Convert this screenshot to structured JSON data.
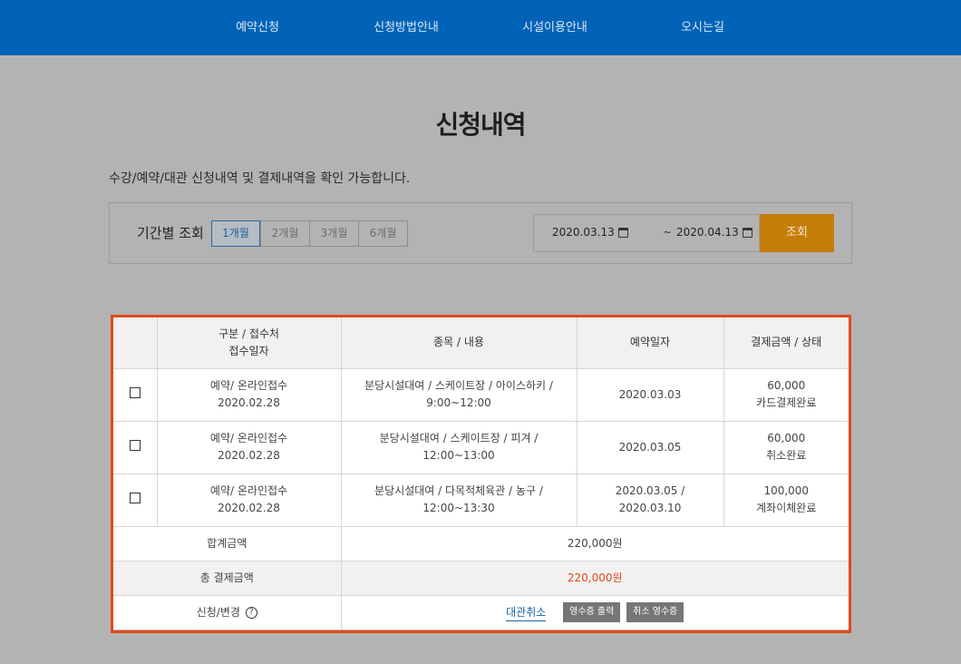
{
  "nav": {
    "items": [
      {
        "label": "예약신청"
      },
      {
        "label": "신청방법안내"
      },
      {
        "label": "시설이용안내"
      },
      {
        "label": "오시는길"
      }
    ]
  },
  "page": {
    "title": "신청내역",
    "description": "수강/예약/대관 신청내역 및 결제내역을 확인 가능합니다."
  },
  "filter": {
    "label": "기간별 조회",
    "periods": [
      {
        "label": "1개월",
        "active": true
      },
      {
        "label": "2개월",
        "active": false
      },
      {
        "label": "3개월",
        "active": false
      },
      {
        "label": "6개월",
        "active": false
      }
    ],
    "start_date": "2020.03.13",
    "separator": "~",
    "end_date": "2020.04.13",
    "search_label": "조회"
  },
  "table": {
    "headers": {
      "col1_line1": "구분 / 접수처",
      "col1_line2": "접수일자",
      "col2": "종목 / 내용",
      "col3": "예약일자",
      "col4": "결제금액 / 상태"
    },
    "rows": [
      {
        "type": "예약/ 온라인접수",
        "received": "2020.02.28",
        "content_line1": "분당시설대여 / 스케이트장 / 아이스하키 /",
        "content_line2": "9:00~12:00",
        "date_line1": "2020.03.03",
        "date_line2": "",
        "amount": "60,000",
        "status": "카드결제완료"
      },
      {
        "type": "예약/ 온라인접수",
        "received": "2020.02.28",
        "content_line1": "분당시설대여 / 스케이트장 / 피겨 /",
        "content_line2": "12:00~13:00",
        "date_line1": "2020.03.05",
        "date_line2": "",
        "amount": "60,000",
        "status": "취소완료"
      },
      {
        "type": "예약/ 온라인접수",
        "received": "2020.02.28",
        "content_line1": "분당시설대여 / 다목적체육관 / 농구 /",
        "content_line2": "12:00~13:30",
        "date_line1": "2020.03.05 /",
        "date_line2": "2020.03.10",
        "amount": "100,000",
        "status": "계좌이체완료"
      }
    ],
    "sum_label": "합계금액",
    "sum_value": "220,000원",
    "total_label": "총 결제금액",
    "total_value": "220,000원",
    "action_label": "신청/변경",
    "help_glyph": "?",
    "cancel_label": "대관취소",
    "receipt_label": "영수증 출력",
    "cancel_receipt_label": "취소 영수증"
  },
  "colors": {
    "nav_bg": "#0063b7",
    "search_button": "#c57d09",
    "highlight_border": "#e2491a",
    "total_value": "#e2491a",
    "link": "#1a63a5"
  }
}
